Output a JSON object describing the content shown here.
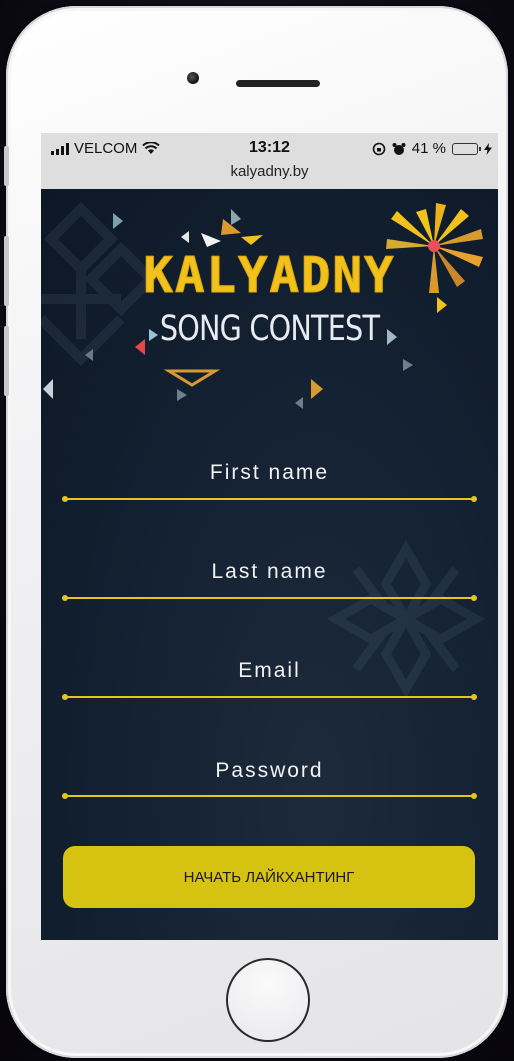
{
  "status_bar": {
    "carrier": "VELCOM",
    "time": "13:12",
    "url": "kalyadny.by",
    "battery_percent": "41 %",
    "battery_level": 0.41
  },
  "logo": {
    "title": "KALYADNY",
    "subtitle": "SONG CONTEST"
  },
  "form": {
    "first_name_label": "First name",
    "last_name_label": "Last name",
    "email_label": "Email",
    "password_label": "Password",
    "submit_label": "НАЧАТЬ ЛАЙКХАНТИНГ"
  },
  "colors": {
    "accent": "#d6c311",
    "background": "#101d2d",
    "text": "#f2f2f2"
  },
  "icons": [
    "signal-icon",
    "wifi-icon",
    "lock-rotation-icon",
    "alarm-icon",
    "battery-icon",
    "charging-icon"
  ]
}
